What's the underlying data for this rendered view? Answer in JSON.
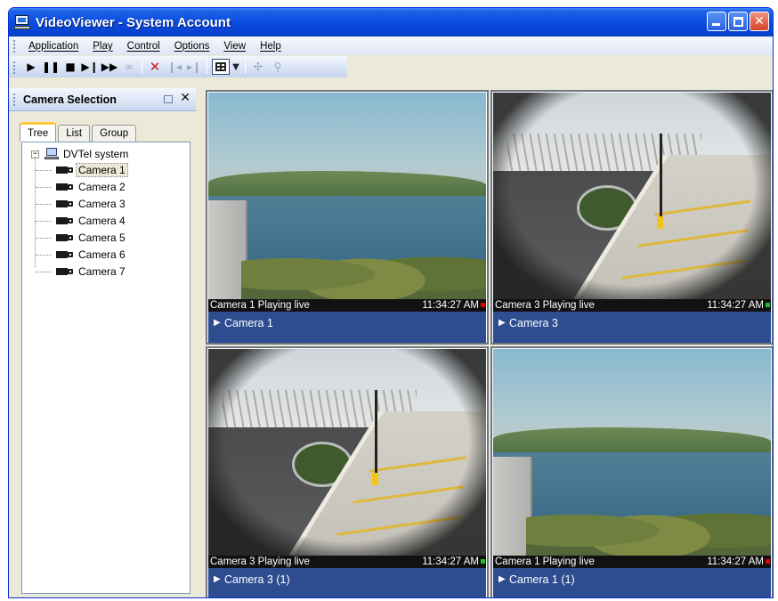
{
  "window": {
    "title": "VideoViewer - System Account"
  },
  "menu": {
    "items": [
      "Application",
      "Play",
      "Control",
      "Options",
      "View",
      "Help"
    ]
  },
  "toolbar": {
    "icons": [
      "play-icon",
      "pause-icon",
      "stop-icon",
      "step-play-icon",
      "skip-forward-icon",
      "binoculars-icon",
      "delete-icon",
      "previous-frame-icon",
      "next-frame-icon",
      "layout-grid-icon",
      "dropdown-icon",
      "camera-control-icon",
      "zoom-icon"
    ]
  },
  "panel": {
    "title": "Camera Selection",
    "tabs": [
      "Tree",
      "List",
      "Group"
    ],
    "active_tab": "Tree",
    "tree": {
      "root": "DVTel system",
      "cameras": [
        "Camera 1",
        "Camera 2",
        "Camera 3",
        "Camera 4",
        "Camera 5",
        "Camera 6",
        "Camera 7"
      ],
      "selected": "Camera 1"
    }
  },
  "tiles": [
    {
      "status": "Camera 1 Playing live",
      "time": "11:34:27 AM",
      "indicator_color": "#e00000",
      "caption": "Camera 1",
      "scene": "river"
    },
    {
      "status": "Camera 3 Playing live",
      "time": "11:34:27 AM",
      "indicator_color": "#20c020",
      "caption": "Camera 3",
      "scene": "parking"
    },
    {
      "status": "Camera 3 Playing live",
      "time": "11:34:27 AM",
      "indicator_color": "#20c020",
      "caption": "Camera 3 (1)",
      "scene": "parking"
    },
    {
      "status": "Camera 1 Playing live",
      "time": "11:34:27 AM",
      "indicator_color": "#e00000",
      "caption": "Camera 1 (1)",
      "scene": "river"
    }
  ],
  "colors": {
    "titlebar": "#0a4ce0",
    "caption_bar": "#2d4d90",
    "status_bar": "#111111"
  }
}
